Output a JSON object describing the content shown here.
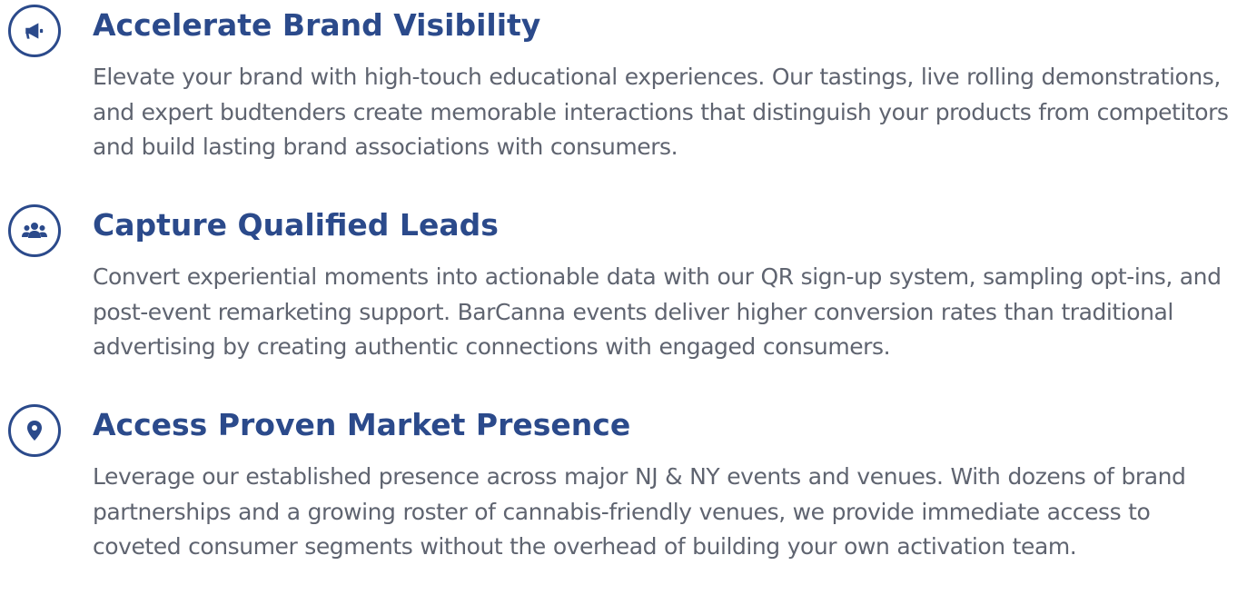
{
  "colors": {
    "heading": "#2b4a8b",
    "body_text": "#5f6470",
    "icon": "#2b4a8b",
    "background": "#ffffff"
  },
  "features": [
    {
      "icon": "megaphone-icon",
      "title": "Accelerate Brand Visibility",
      "description": "Elevate your brand with high-touch educational experiences. Our tastings, live rolling demonstrations, and expert budtenders create memorable interactions that distinguish your products from competitors and build lasting brand associations with consumers."
    },
    {
      "icon": "users-icon",
      "title": "Capture Qualified Leads",
      "description": "Convert experiential moments into actionable data with our QR sign-up system, sampling opt-ins, and post-event remarketing support. BarCanna events deliver higher conversion rates than traditional advertising by creating authentic connections with engaged consumers."
    },
    {
      "icon": "map-pin-icon",
      "title": "Access Proven Market Presence",
      "description": "Leverage our established presence across major NJ & NY events and venues. With dozens of brand partnerships and a growing roster of cannabis-friendly venues, we provide immediate access to coveted consumer segments without the overhead of building your own activation team."
    }
  ]
}
